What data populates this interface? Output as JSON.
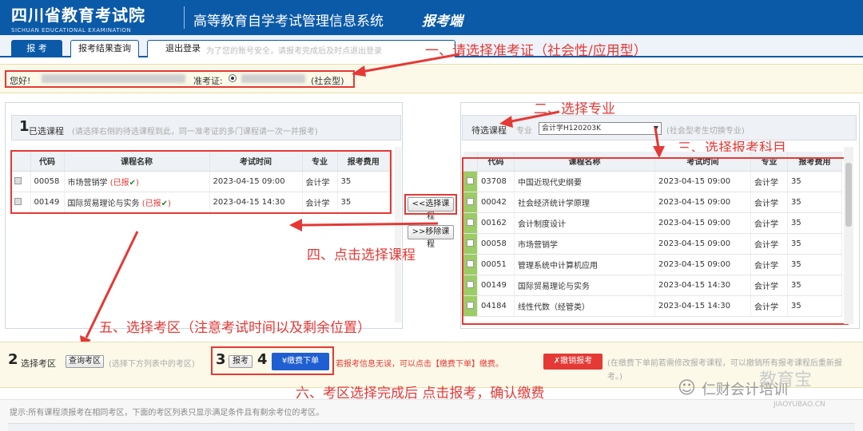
{
  "header": {
    "logo_cn": "四川省教育考试院",
    "logo_en": "SICHUAN EDUCATIONAL EXAMINATION",
    "system_title": "高等教育自学考试管理信息系统",
    "system_sub": "报考端"
  },
  "nav": {
    "tab1": "报 考",
    "tab2": "报考结果查询",
    "tab3": "退出登录",
    "note": "为了您的账号安全，请报考完成后及时点退出登录"
  },
  "annotations": {
    "a1": "一、请选择准考证（社会性/应用型）",
    "a2": "二、选择专业",
    "a3": "三、选择报考科目",
    "a4": "四、点击选择课程",
    "a5": "五、选择考区（注意考试时间以及剩余位置）",
    "a6": "六、考区选择完成后 点击报考，确认缴费"
  },
  "user": {
    "greeting": "您好!",
    "admission_label": "准考证:",
    "admission_type": "(社会型)"
  },
  "selected": {
    "step": "1",
    "title": "已选课程",
    "hint": "(请选择右侧的待选课程到此，同一准考证的多门课程请一次一并报考)",
    "headers": [
      "代码",
      "课程名称",
      "考试时间",
      "专业",
      "报考费用"
    ],
    "rows": [
      {
        "code": "00058",
        "name": "市场营销学",
        "status": "(已报",
        "time": "2023-04-15 09:00",
        "major": "会计学",
        "fee": "35"
      },
      {
        "code": "00149",
        "name": "国际贸易理论与实务",
        "status": "(已报",
        "time": "2023-04-15 14:30",
        "major": "会计学",
        "fee": "35"
      }
    ]
  },
  "actions": {
    "select": "<<选择课程",
    "remove": ">>移除课程"
  },
  "pending": {
    "title": "待选课程",
    "major_label": "专业",
    "major_value": "会计学H120203K",
    "hint": "(社会型考生切换专业)",
    "headers": [
      "代码",
      "课程名称",
      "考试时间",
      "专业",
      "报考费用"
    ],
    "rows": [
      {
        "code": "03708",
        "name": "中国近现代史纲要",
        "time": "2023-04-15 09:00",
        "major": "会计学",
        "fee": "35"
      },
      {
        "code": "00042",
        "name": "社会经济统计学原理",
        "time": "2023-04-15 09:00",
        "major": "会计学",
        "fee": "35"
      },
      {
        "code": "00162",
        "name": "会计制度设计",
        "time": "2023-04-15 09:00",
        "major": "会计学",
        "fee": "35"
      },
      {
        "code": "00058",
        "name": "市场营销学",
        "time": "2023-04-15 09:00",
        "major": "会计学",
        "fee": "35"
      },
      {
        "code": "00051",
        "name": "管理系统中计算机应用",
        "time": "2023-04-15 09:00",
        "major": "会计学",
        "fee": "35"
      },
      {
        "code": "00149",
        "name": "国际贸易理论与实务",
        "time": "2023-04-15 14:30",
        "major": "会计学",
        "fee": "35"
      },
      {
        "code": "04184",
        "name": "线性代数（经管类）",
        "time": "2023-04-15 14:30",
        "major": "会计学",
        "fee": "35"
      }
    ]
  },
  "bottom": {
    "step2": "2",
    "step2_label": "选择考区",
    "query_btn": "查询考区",
    "step2_hint": "(选择下方列表中的考区)",
    "step3": "3",
    "report_btn": "报考",
    "step4": "4",
    "pay_btn": "¥缴费下单",
    "pay_hint": "若报考信息无误，可以点击【缴费下单】缴费。",
    "cancel_btn": "✗撤销报考",
    "cancel_hint": "(在缴费下单前若需修改报考课程，可以撤销所有报考课程后重新报考。)",
    "tip": "提示:所有课程须报考在相同考区，下面的考区列表只显示满足条件且有剩余考位的考区。"
  },
  "watermark": {
    "brand": "仁财会计培训",
    "site": "教育宝",
    "domain": "JIAOYUBAO.CN"
  }
}
